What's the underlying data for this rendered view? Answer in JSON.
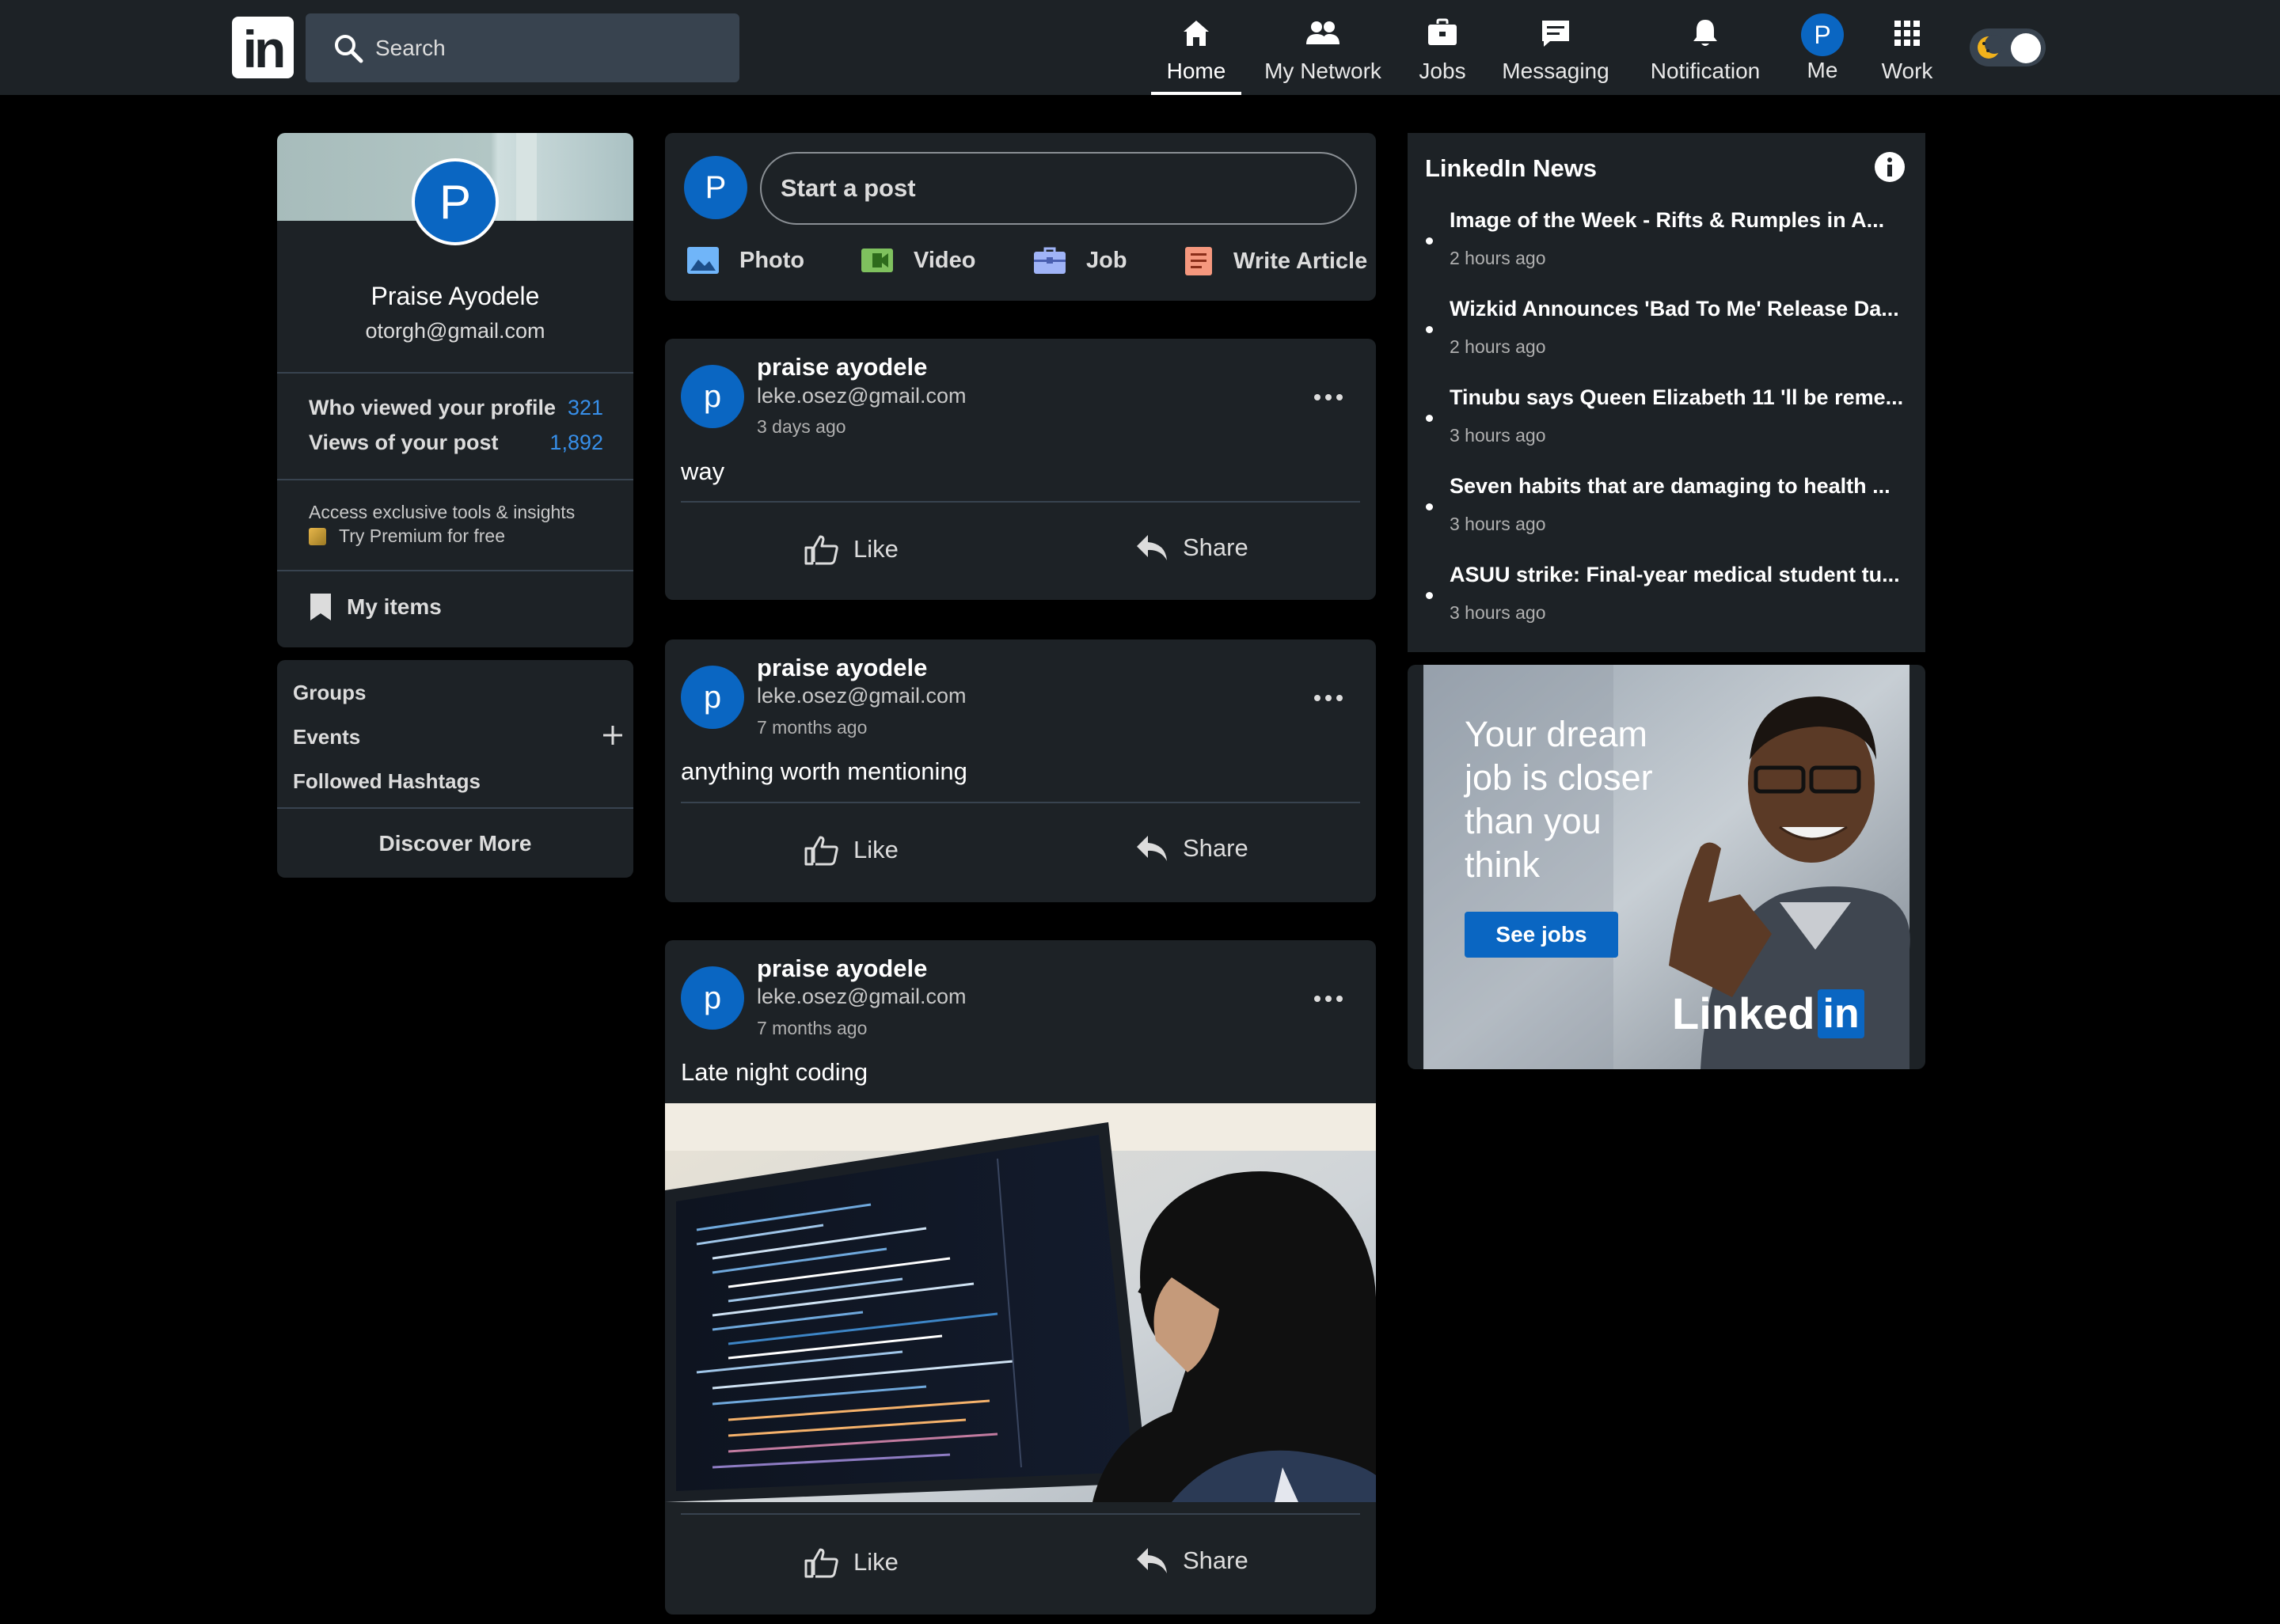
{
  "header": {
    "logo_text": "in",
    "search_placeholder": "Search",
    "nav": [
      {
        "label": "Home",
        "icon": "home-icon",
        "active": true
      },
      {
        "label": "My Network",
        "icon": "network-icon"
      },
      {
        "label": "Jobs",
        "icon": "briefcase-icon"
      },
      {
        "label": "Messaging",
        "icon": "message-icon"
      },
      {
        "label": "Notification",
        "icon": "bell-icon"
      },
      {
        "label": "Me",
        "icon": "avatar",
        "avatar_letter": "P"
      },
      {
        "label": "Work",
        "icon": "grid-icon"
      }
    ],
    "theme_toggle": "dark-mode-toggle"
  },
  "profile": {
    "avatar_letter": "P",
    "name": "Praise Ayodele",
    "email": "otorgh@gmail.com",
    "stats": [
      {
        "label": "Who viewed your profile",
        "value": "321"
      },
      {
        "label": "Views of your post",
        "value": "1,892"
      }
    ],
    "premium_text": "Access exclusive tools & insights",
    "premium_link": "Try Premium for free",
    "my_items": "My items"
  },
  "community": {
    "items": [
      "Groups",
      "Events",
      "Followed Hashtags"
    ],
    "discover": "Discover More"
  },
  "composer": {
    "avatar_letter": "P",
    "placeholder": "Start a post",
    "actions": [
      {
        "label": "Photo",
        "icon": "photo-icon",
        "color": "#70b5f9"
      },
      {
        "label": "Video",
        "icon": "video-icon",
        "color": "#7fc15e"
      },
      {
        "label": "Job",
        "icon": "job-icon",
        "color": "#a0b4f7"
      },
      {
        "label": "Write Article",
        "icon": "article-icon",
        "color": "#f5987e"
      }
    ]
  },
  "posts": [
    {
      "avatar_letter": "p",
      "author": "praise ayodele",
      "email": "leke.osez@gmail.com",
      "time": "3 days ago",
      "text": "way",
      "like": "Like",
      "share": "Share"
    },
    {
      "avatar_letter": "p",
      "author": "praise ayodele",
      "email": "leke.osez@gmail.com",
      "time": "7 months ago",
      "text": "anything worth mentioning",
      "like": "Like",
      "share": "Share"
    },
    {
      "avatar_letter": "p",
      "author": "praise ayodele",
      "email": "leke.osez@gmail.com",
      "time": "7 months ago",
      "text": "Late night coding",
      "like": "Like",
      "share": "Share",
      "image": "person-coding-at-monitor"
    }
  ],
  "news": {
    "title": "LinkedIn News",
    "items": [
      {
        "headline": "Image of the Week - Rifts & Rumples in A...",
        "time": "2 hours ago"
      },
      {
        "headline": "Wizkid Announces 'Bad To Me' Release Da...",
        "time": "2 hours ago"
      },
      {
        "headline": "Tinubu says Queen Elizabeth 11 'll be reme...",
        "time": "3 hours ago"
      },
      {
        "headline": "Seven habits that are damaging to health ...",
        "time": "3 hours ago"
      },
      {
        "headline": "ASUU strike: Final-year medical student tu...",
        "time": "3 hours ago"
      }
    ]
  },
  "ad": {
    "line1": "Your dream",
    "line2": "job is closer",
    "line3": "than you",
    "line4": "think",
    "cta": "See jobs",
    "brand_text": "Linked",
    "brand_box": "in"
  },
  "colors": {
    "background": "#000000",
    "card": "#1d2226",
    "accent": "#0a66c2",
    "link": "#378fe9"
  }
}
